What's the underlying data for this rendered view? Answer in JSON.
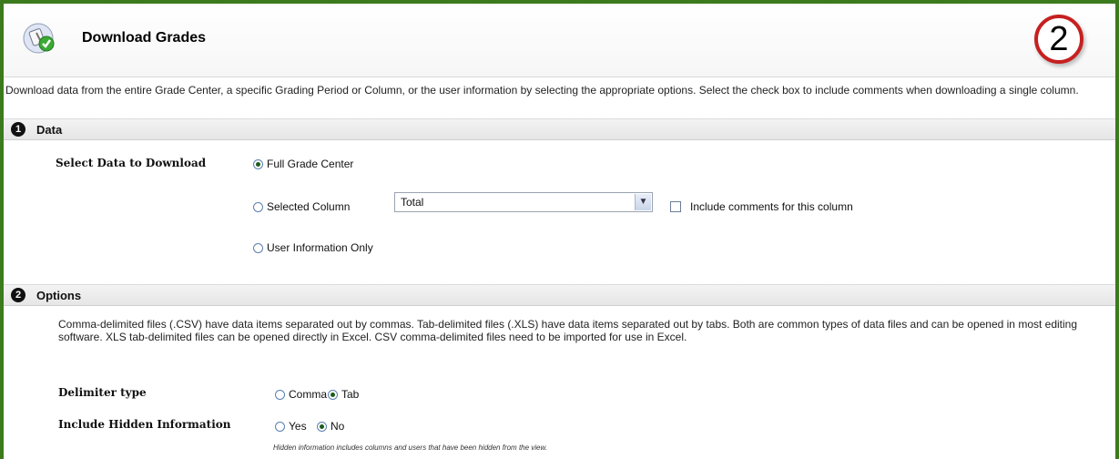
{
  "header": {
    "title": "Download Grades",
    "step_badge": "2"
  },
  "intro_text": "Download data from the entire Grade Center, a specific Grading Period or Column, or the user information by selecting the appropriate options. Select the check box to include comments when downloading a single column.",
  "data_section": {
    "number": "1",
    "title": "Data",
    "select_label": "Select Data to Download",
    "options": [
      {
        "label": "Full Grade Center",
        "selected": true
      },
      {
        "label": "Selected Column",
        "selected": false
      },
      {
        "label": "User Information Only",
        "selected": false
      }
    ],
    "column_select_value": "Total",
    "include_comments_label": "Include comments for this column",
    "include_comments_checked": false
  },
  "options_section": {
    "number": "2",
    "title": "Options",
    "description": "Comma-delimited files (.CSV) have data items separated out by commas. Tab-delimited files (.XLS) have data items separated out by tabs. Both are common types of data files and can be opened in most editing software. XLS tab-delimited files can be opened directly in Excel. CSV comma-delimited files need to be imported for use in Excel.",
    "delimiter_label": "Delimiter type",
    "delimiter_options": [
      {
        "label": "Comma",
        "selected": false
      },
      {
        "label": "Tab",
        "selected": true
      }
    ],
    "hidden_label": "Include Hidden Information",
    "hidden_options": [
      {
        "label": "Yes",
        "selected": false
      },
      {
        "label": "No",
        "selected": true
      }
    ],
    "hidden_note": "Hidden information includes columns and users that have been hidden from the view."
  },
  "colors": {
    "frame_border": "#3c7a1e",
    "badge_ring": "#c62020"
  }
}
